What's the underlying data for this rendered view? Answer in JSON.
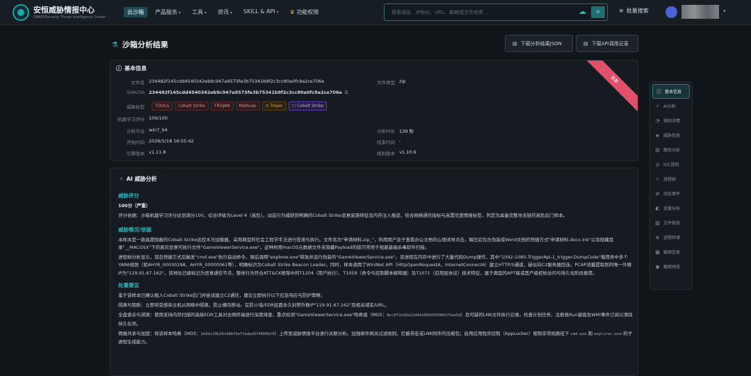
{
  "app": {
    "name_cn": "安恒威胁情报中心",
    "name_en": "DBAPPSecurity Threat Intelligence Center"
  },
  "nav": [
    {
      "label": "云沙箱",
      "active": true,
      "caret": false
    },
    {
      "label": "产品服务",
      "caret": true
    },
    {
      "label": "工具",
      "caret": true
    },
    {
      "label": "资讯",
      "caret": true
    },
    {
      "label": "SKILL & API",
      "caret": true
    },
    {
      "label": "功能权限",
      "caret": false
    }
  ],
  "search": {
    "placeholder": "搜索域名、IP地址、URL、邮箱或文件哈希..."
  },
  "header": {
    "batch_search": "批量搜索"
  },
  "page": {
    "title": "沙箱分析结果",
    "btn_download_json": "下载分析结果JSON",
    "btn_download_api": "下载API调用记录"
  },
  "basic": {
    "title": "基本信息",
    "ribbon": "恶意",
    "file_name_k": "文件名",
    "file_name_v": "234482f145cdd4540342eb9c947a9573fe3b75341b9f2c3cc80a0fc9a2ce706e",
    "file_type_k": "文件类型",
    "file_type_v": "zip",
    "sha256_k": "SHA256",
    "sha256_v": "234482f145cdd4540342eb9c947a9573fe3b75341b9f2c3cc80a0fc9a2ce706e",
    "tags_k": "威胁标签",
    "tags": [
      {
        "text": "TOOLS",
        "style": "red"
      },
      {
        "text": "Cobalt Strike",
        "style": "red"
      },
      {
        "text": "TROJAN",
        "style": "red"
      },
      {
        "text": "MalSusp",
        "style": "red"
      },
      {
        "text": "⊙ Trojan",
        "style": "orange"
      },
      {
        "text": "⬡ Cobalt Strike",
        "style": "purple"
      }
    ],
    "ml_k": "机器学习评分",
    "ml_v": "100/100",
    "platform_k": "分析平台",
    "platform_v": "win7_64",
    "duration_k": "分析时长",
    "duration_v": "139 秒",
    "start_k": "开始时间",
    "start_v": "2026/5/18 16:55:42",
    "end_k": "结束时间",
    "end_v": "-",
    "engine_k": "引擎版本",
    "engine_v": "v1.11.8",
    "rule_k": "规则版本",
    "rule_v": "v1.10.6"
  },
  "ai": {
    "title": "AI 威胁分析",
    "score_h": "威胁评分",
    "score_line": "100分（严重）",
    "score_desc": "评分依据：沙箱机器学习评分达到满分100，综合评级为Level 4（高危）。动态行为捕获到明确的Cobalt Strike恶意家族特征及内存注入痕迹，结合网络通信指标与高置信度情报标签，判定为具备完整攻击链的高危后门样本。",
    "detail_h": "威胁情况/依据",
    "detail_p1": "本样本是一款高度隐蔽的Cobalt Strike远控木马加载器，采用典型的社会工程学手法进行投递与执行。文件名为\"申请材料.zip_\"，利用用户急于查看办公文档的心理诱导点击。解压后包含伪装成Word文档的快捷方式\"申请材料.docx.lnk\"以及隐藏目录\"__MACOSX\"下的真实恶意可执行文件\"GameViewerService.exe\"。这种利用macOS元数据文件夹隐藏Payload的技巧常用于规避基础杀毒软件扫描。",
    "detail_p2": "进程树分析显示，双击快捷方式后触发\"cmd.exe\"执行启动命令，随后调用\"explorer.exe\"释放并运行伪装的\"GameViewerService.exe\"。该进程在内存中进行了大量代码Dump操作，其中\"1092-1080-TriggerApi-1_trigger.DumpCode\"载荷命中多个YARA规则（如AHYR_00030298、AHYR_00000061等），明确标识为Cobalt Strike Beacon Loader。同时，样本调用了WinINet API（HttpOpenRequestA、InternetConnectA）建立HTTP/S通道，疑似向C2服务器回连。PCAP流量提取到的唯一外联IP为\"119.91.67.162\"，该地址已被标记为恶意通信节点。整体行为符合ATT&CK框架中的T1204（用户执行）、T1059（命令与控制脚本解释器）及T1071（应用层协议）技术特征，属于典型的APT级或黑产级初始访问与持久化阶段载荷。",
    "advice_h": "处置建议",
    "advice_p0": "鉴于该样本已确认植入Cobalt Strike后门并尝试建立C2通信，建议立即执行以下应急响应与防护策略：",
    "advice_1": "隔离与阻断：立即将受感染主机从网络中隔离，防止横向移动。在防火墙/EDR层面永久封禁外联IP\"119.91.67.162\"及相关域名/URL。",
    "advice_2a": "全盘查杀与溯源：使用支持内存扫描的高级EDR工具对全网终端进行深度排查，重点检测\"GameViewerService.exe\"哈希值（MD5：",
    "advice_2_md5": "8cc972a10a12d4416034550891f5ae5d",
    "advice_2b": "）及可疑的LNK文件执行记录。检查计划任务、注册表Run键值及WMI事件订阅以清除持久化项。",
    "advice_3a": "情报共享与加固：将该样本哈希（MD5：",
    "advice_3_md5": "1b0dc10b26c98bf5e7fadad3f4600bf0",
    "advice_3b": "）上传至威胁情报平台进行关联分析。加强邮件网关过滤规则，拦截带宏或LNK附件的压缩包；启用应用程序控制（AppLocker）限制非常规路径下",
    "advice_3_cmd": "cmd.exe",
    "advice_3_and": "和",
    "advice_3_exp": "explorer.exe",
    "advice_3c": "的子进程生成能力。"
  },
  "sidenav": [
    {
      "label": "基本信息",
      "icon": "ⓘ",
      "active": true
    },
    {
      "label": "AI分析",
      "icon": "✧"
    },
    {
      "label": "规则详情",
      "icon": "◔"
    },
    {
      "label": "威胁信息",
      "icon": "◈"
    },
    {
      "label": "静态分析",
      "icon": "▤"
    },
    {
      "label": "IOC提取",
      "icon": "◎"
    },
    {
      "label": "进程树",
      "icon": "⑂"
    },
    {
      "label": "动态事件",
      "icon": "⇄"
    },
    {
      "label": "流量分析",
      "icon": "◐"
    },
    {
      "label": "文件释放",
      "icon": "▧"
    },
    {
      "label": "进程转储",
      "icon": "⊕"
    },
    {
      "label": "截图信息",
      "icon": "▦"
    },
    {
      "label": "截图预览",
      "icon": "◉"
    }
  ],
  "colors": {
    "accent": "#2fb6bd",
    "danger": "#e0506b",
    "bg": "#101519"
  }
}
